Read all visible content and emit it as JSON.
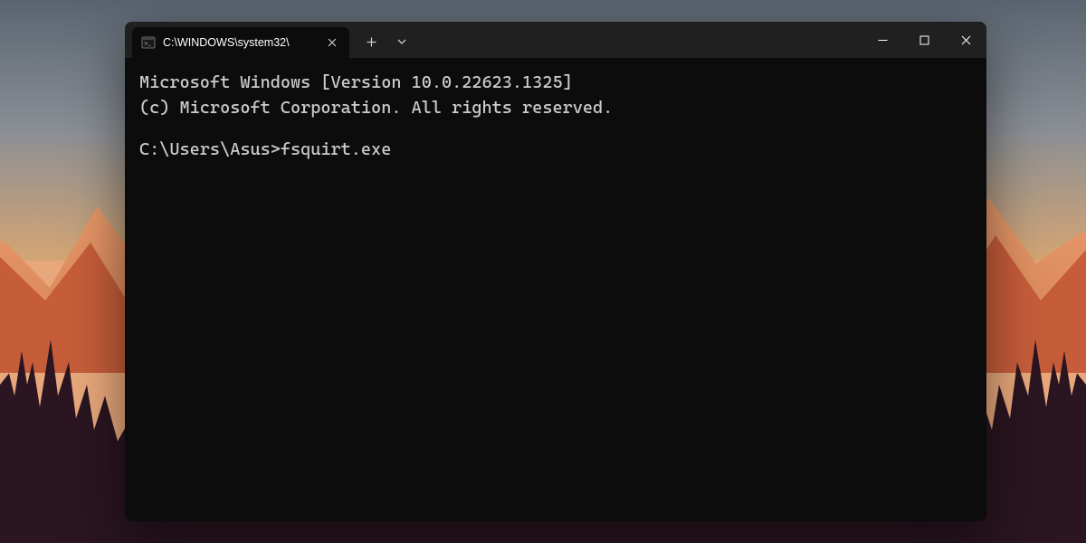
{
  "tab": {
    "title": "C:\\WINDOWS\\system32\\"
  },
  "terminal": {
    "line1": "Microsoft Windows [Version 10.0.22623.1325]",
    "line2": "(c) Microsoft Corporation. All rights reserved.",
    "prompt": "C:\\Users\\Asus>",
    "command": "fsquirt.exe"
  }
}
